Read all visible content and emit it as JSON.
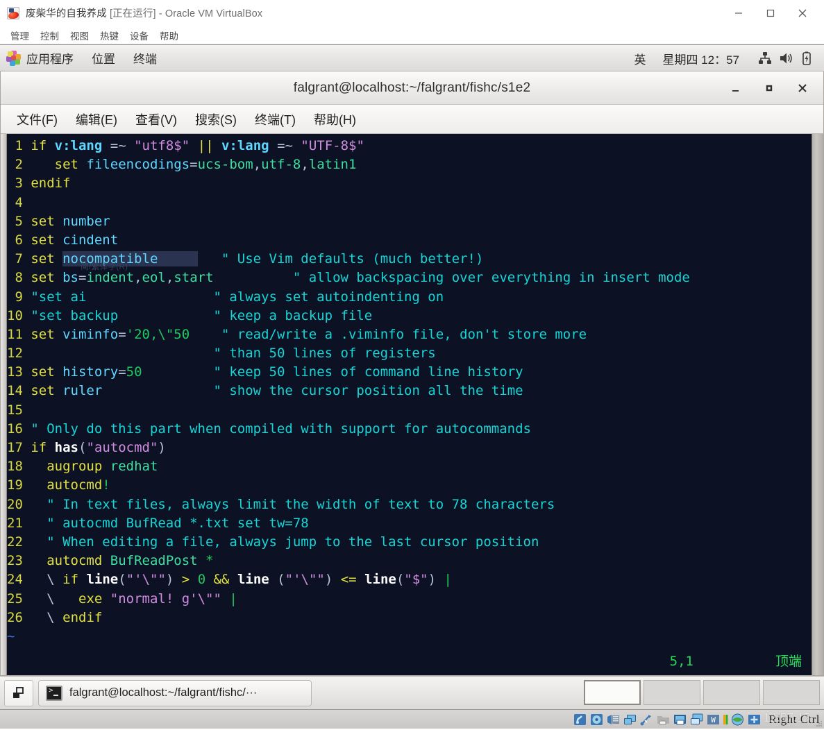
{
  "vbox": {
    "title_main": "废柴华的自我养成",
    "title_state": "[正在运行]",
    "title_suffix": "- Oracle VM VirtualBox",
    "app_icon": "virtualbox-icon",
    "menu": [
      "管理",
      "控制",
      "视图",
      "热键",
      "设备",
      "帮助"
    ],
    "window_buttons": {
      "minimize": "minimize-icon",
      "maximize": "maximize-icon",
      "close": "close-icon"
    },
    "statusbar": {
      "icons": [
        "hard-disk-icon",
        "optical-disk-icon",
        "floppy-icon",
        "network-icon",
        "usb-icon",
        "shared-folder-icon",
        "display-icon",
        "remote-display-icon",
        "recording-icon",
        "cpu-load-icon",
        "globe-icon",
        "mouse-capture-icon"
      ],
      "host_key": "Right Ctrl",
      "clock_overlay": "12:57:15"
    }
  },
  "gnome": {
    "panel": {
      "apps_icon": "applications-pinwheel-icon",
      "items": [
        "应用程序",
        "位置",
        "终端"
      ],
      "ime": "英",
      "clock": "星期四 12：57",
      "tray": [
        "network-icon",
        "volume-icon",
        "battery-icon"
      ]
    },
    "taskbar": {
      "show_desktop": "show-desktop-icon",
      "window_icon": "terminal-icon",
      "window_label": "falgrant@localhost:~/falgrant/fishc/···",
      "workspaces": [
        {
          "active": true
        },
        {
          "active": false
        },
        {
          "active": false
        },
        {
          "active": false
        }
      ]
    }
  },
  "terminal": {
    "title": "falgrant@localhost:~/falgrant/fishc/s1e2",
    "window_buttons": {
      "minimize": "_",
      "maximize": "▪",
      "close": "✕"
    },
    "menu": [
      "文件(F)",
      "编辑(E)",
      "查看(V)",
      "搜索(S)",
      "终端(T)",
      "帮助(H)"
    ]
  },
  "vim": {
    "ruler": "5,1",
    "position_label": "顶端",
    "ime_ghost": "简/繁体字(R)",
    "tilde_marker": "~",
    "lines": [
      {
        "n": 1,
        "text": "if v:lang =~ \"utf8$\" || v:lang =~ \"UTF-8$\""
      },
      {
        "n": 2,
        "text": "    set fileencodings=ucs-bom,utf-8,latin1"
      },
      {
        "n": 3,
        "text": "endif"
      },
      {
        "n": 4,
        "text": ""
      },
      {
        "n": 5,
        "text": "set number"
      },
      {
        "n": 6,
        "text": "set cindent"
      },
      {
        "n": 7,
        "text": "set nocompatible        \" Use Vim defaults (much better!)"
      },
      {
        "n": 8,
        "text": "set bs=indent,eol,start         \" allow backspacing over everything in insert mode"
      },
      {
        "n": 9,
        "text": "\"set ai                 \" always set autoindenting on"
      },
      {
        "n": 10,
        "text": "\"set backup             \" keep a backup file"
      },
      {
        "n": 11,
        "text": "set viminfo='20,\\\"50     \" read/write a .viminfo file, don't store more"
      },
      {
        "n": 12,
        "text": "                        \" than 50 lines of registers"
      },
      {
        "n": 13,
        "text": "set history=50          \" keep 50 lines of command line history"
      },
      {
        "n": 14,
        "text": "set ruler               \" show the cursor position all the time"
      },
      {
        "n": 15,
        "text": ""
      },
      {
        "n": 16,
        "text": "\" Only do this part when compiled with support for autocommands"
      },
      {
        "n": 17,
        "text": "if has(\"autocmd\")"
      },
      {
        "n": 18,
        "text": "  augroup redhat"
      },
      {
        "n": 19,
        "text": "  autocmd!"
      },
      {
        "n": 20,
        "text": "  \" In text files, always limit the width of text to 78 characters"
      },
      {
        "n": 21,
        "text": "  \" autocmd BufRead *.txt set tw=78"
      },
      {
        "n": 22,
        "text": "  \" When editing a file, always jump to the last cursor position"
      },
      {
        "n": 23,
        "text": "  autocmd BufReadPost *"
      },
      {
        "n": 24,
        "text": "  \\ if line(\"'\\\"\") > 0 && line (\"'\\\"\") <= line(\"$\") |"
      },
      {
        "n": 25,
        "text": "  \\   exe \"normal! g'\\\"\" |"
      },
      {
        "n": 26,
        "text": "  \\ endif"
      }
    ]
  },
  "colors": {
    "vim_bg": "#0d1124",
    "vim_linenumber": "#d8d840",
    "vim_statement": "#e0e040",
    "vim_option": "#5fd7ff",
    "vim_comment": "#17d5d5",
    "vim_string": "#d08de0",
    "vim_number": "#1ec95f",
    "vim_status": "#22dd55",
    "selection": "#2a3350"
  }
}
